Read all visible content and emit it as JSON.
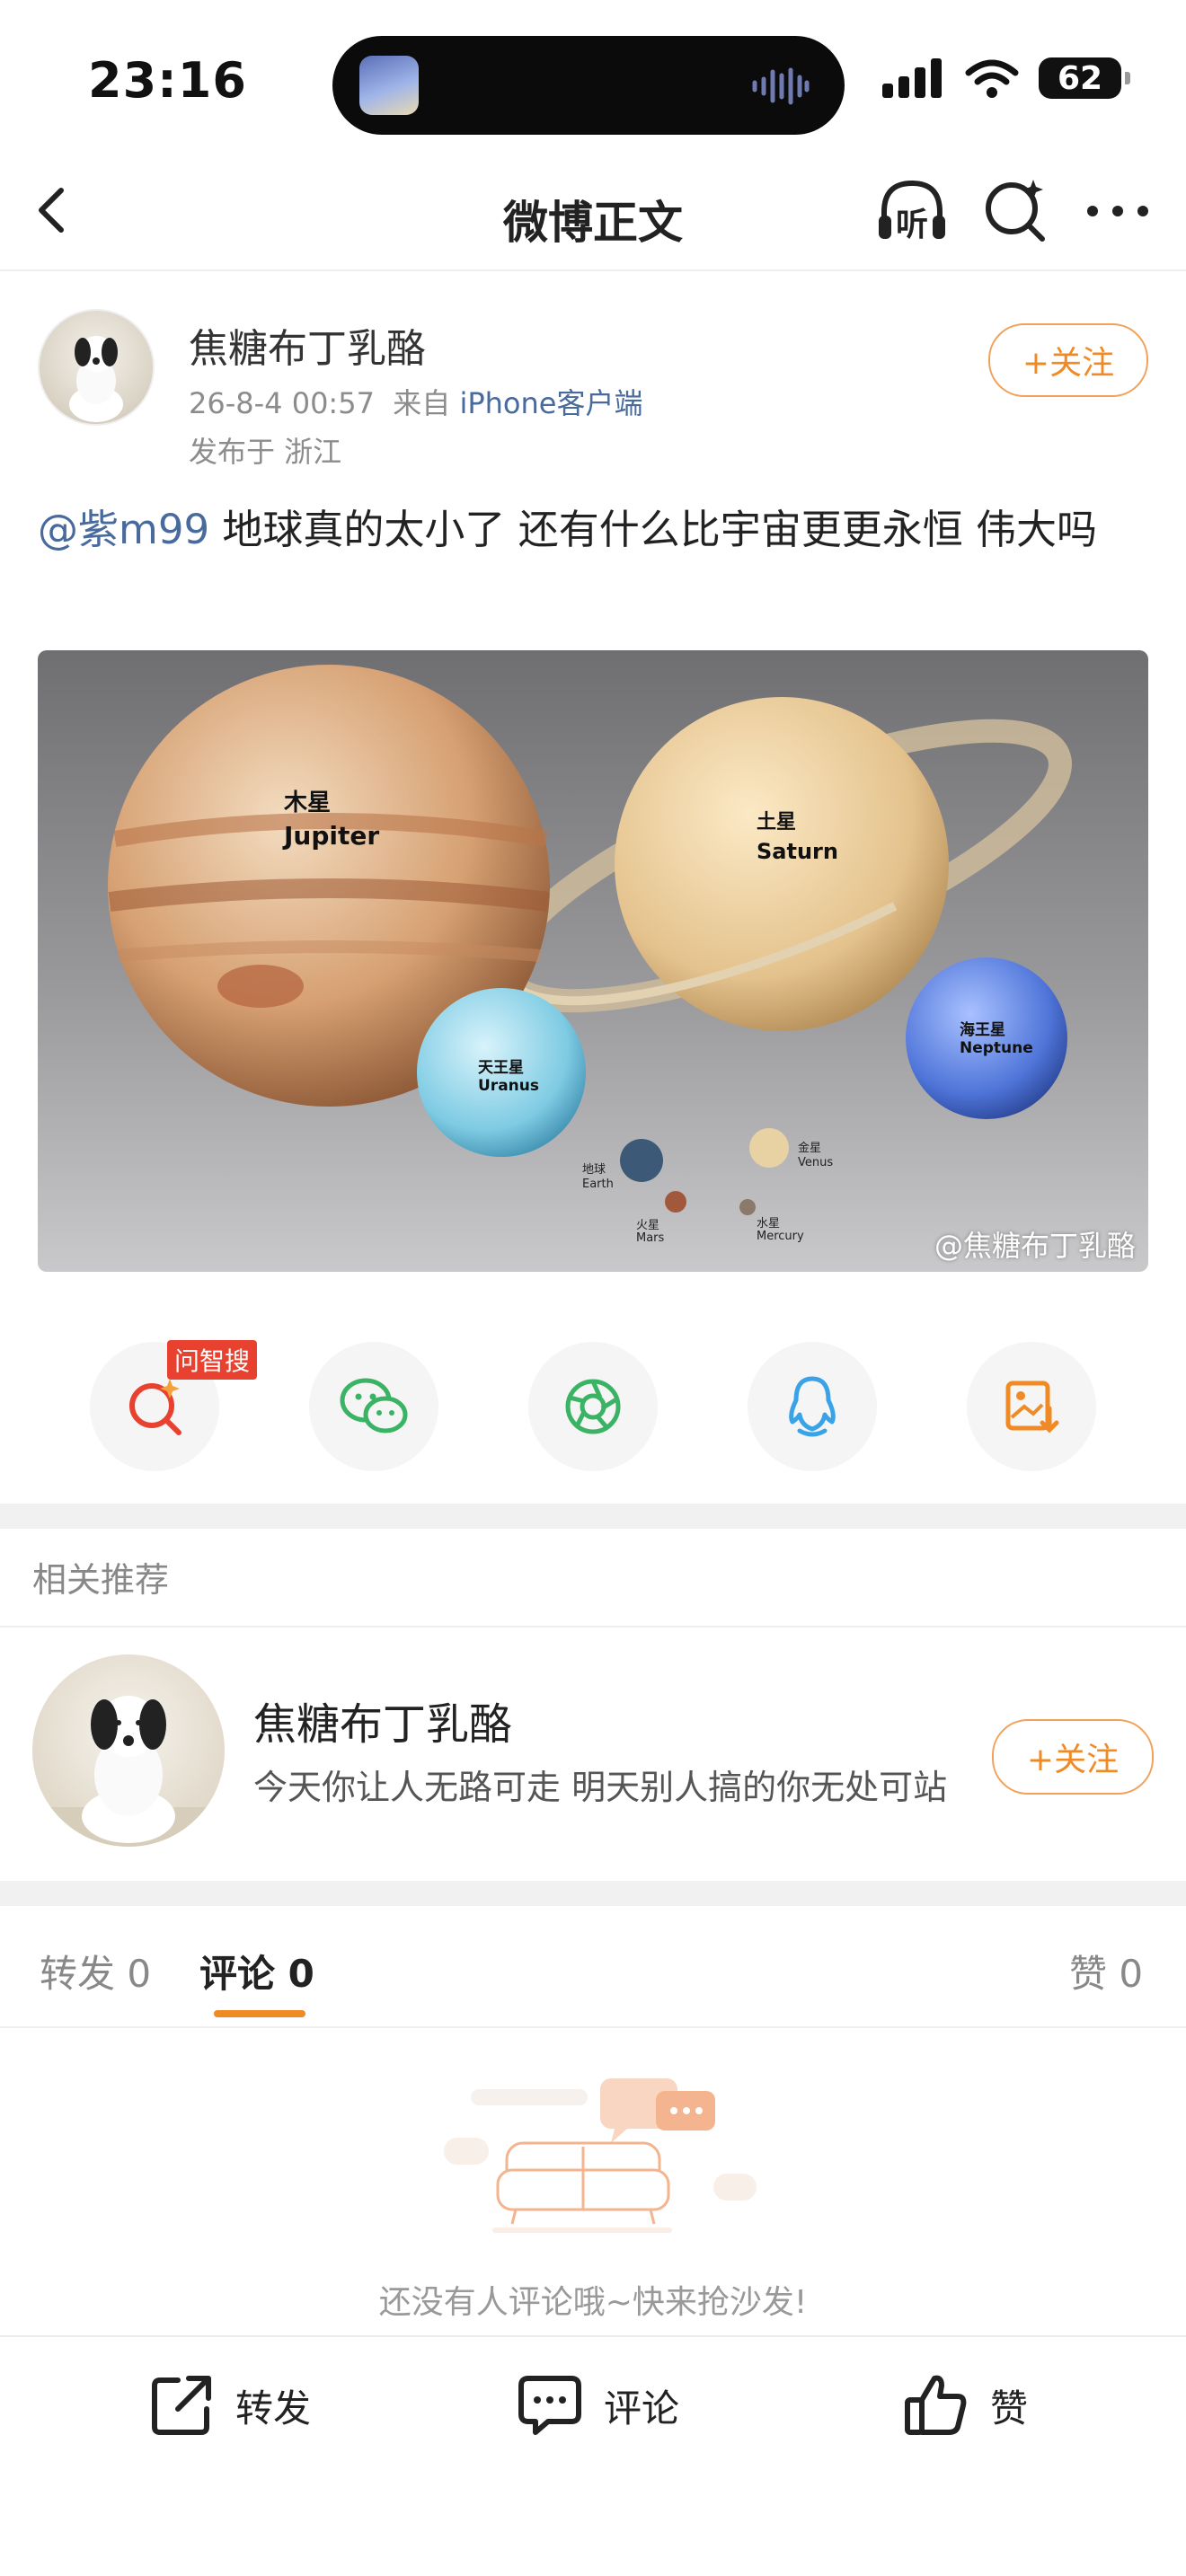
{
  "status_bar": {
    "time": "23:16",
    "battery": "62"
  },
  "nav": {
    "title": "微博正文"
  },
  "post": {
    "username": "焦糖布丁乳酪",
    "time": "26-8-4 00:57",
    "source_prefix": "来自",
    "source": "iPhone客户端",
    "location": "发布于 浙江",
    "follow_label": "+关注",
    "mention": "@紫m99",
    "text": " 地球真的太小了  还有什么比宇宙更更永恒  伟大吗",
    "image_labels": {
      "jupiter_cn": "木星",
      "jupiter_en": "Jupiter",
      "saturn_cn": "土星",
      "saturn_en": "Saturn",
      "uranus_cn": "天王星",
      "uranus_en": "Uranus",
      "neptune_cn": "海王星",
      "neptune_en": "Neptune",
      "earth_cn": "地球",
      "earth_en": "Earth",
      "venus_cn": "金星",
      "venus_en": "Venus",
      "mars_cn": "火星",
      "mars_en": "Mars",
      "mercury_cn": "水星",
      "mercury_en": "Mercury"
    },
    "watermark": "@焦糖布丁乳酪"
  },
  "share": {
    "badge": "问智搜"
  },
  "recommend": {
    "heading": "相关推荐",
    "name": "焦糖布丁乳酪",
    "bio": "今天你让人无路可走  明天别人搞的你无处可站",
    "follow_label": "+关注"
  },
  "tabs": {
    "repost": "转发 0",
    "comment": "评论 0",
    "like": "赞 0"
  },
  "empty_text": "还没有人评论哦~快来抢沙发!",
  "bottom": {
    "repost": "转发",
    "comment": "评论",
    "like": "赞"
  },
  "colors": {
    "accent": "#f08a24",
    "link": "#496a9c"
  }
}
